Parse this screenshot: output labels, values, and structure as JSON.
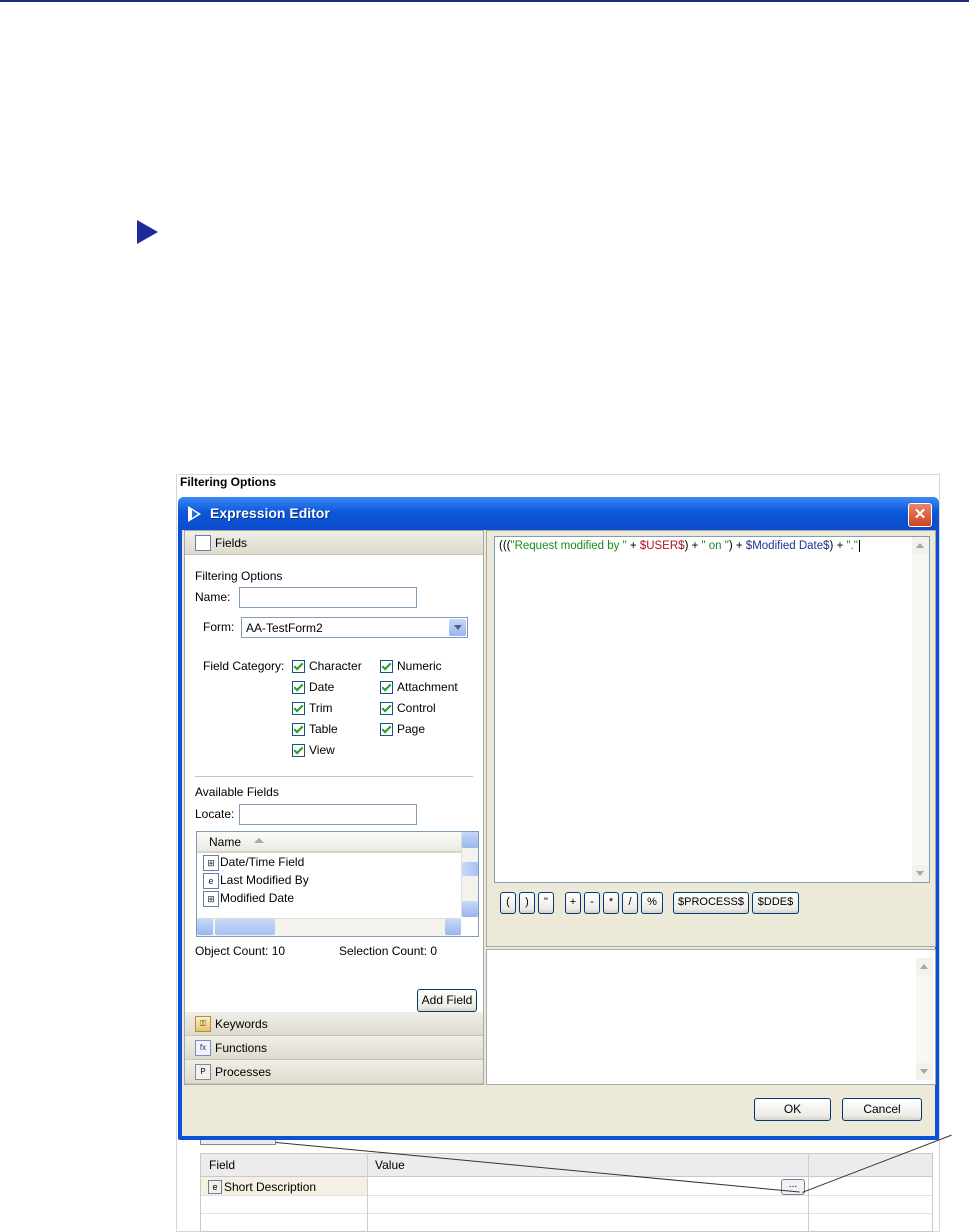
{
  "background": {
    "panel_title": "Filtering Options",
    "table": {
      "headers": [
        "Field",
        "Value"
      ],
      "rows": [
        {
          "field": "Short Description",
          "value": "",
          "browse_label": "..."
        }
      ]
    }
  },
  "dialog": {
    "title": "Expression Editor",
    "close_label": "✕",
    "fields_section": {
      "header": "Fields",
      "filter_group_label": "Filtering Options",
      "name_label": "Name:",
      "name_value": "",
      "form_label": "Form:",
      "form_value": "AA-TestForm2",
      "field_category_label": "Field Category:",
      "categories": [
        {
          "label": "Character",
          "checked": true
        },
        {
          "label": "Numeric",
          "checked": true
        },
        {
          "label": "Date",
          "checked": true
        },
        {
          "label": "Attachment",
          "checked": true
        },
        {
          "label": "Trim",
          "checked": true
        },
        {
          "label": "Control",
          "checked": true
        },
        {
          "label": "Table",
          "checked": true
        },
        {
          "label": "Page",
          "checked": true
        },
        {
          "label": "View",
          "checked": true
        }
      ],
      "available_fields_label": "Available Fields",
      "locate_label": "Locate:",
      "locate_value": "",
      "list_header": "Name",
      "list_items": [
        {
          "icon": "date-time-field-icon",
          "glyph": "⊞",
          "label": "Date/Time Field"
        },
        {
          "icon": "character-field-icon",
          "glyph": "e",
          "label": "Last Modified By"
        },
        {
          "icon": "date-time-field-icon",
          "glyph": "⊞",
          "label": "Modified Date"
        }
      ],
      "object_count": "Object Count: 10",
      "selection_count": "Selection Count: 0",
      "add_field_label": "Add Field"
    },
    "keywords_header": "Keywords",
    "functions_header": "Functions",
    "processes_header": "Processes",
    "expression": {
      "p1": "(((",
      "s1": "\"Request modified by \"",
      "op1": " + ",
      "k1": "$USER$",
      "p2": ") + ",
      "s2": "\" on \"",
      "p3": ") + ",
      "k2": "$Modified Date$",
      "p4": ") + ",
      "s3": "\".\""
    },
    "operators": [
      "(",
      ")",
      "\"",
      "+",
      "-",
      "*",
      "/",
      "%",
      "$PROCESS$",
      "$DDE$"
    ],
    "ok_label": "OK",
    "cancel_label": "Cancel"
  }
}
